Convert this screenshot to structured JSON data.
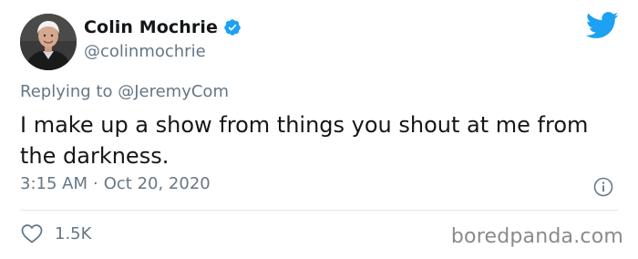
{
  "tweet": {
    "display_name": "Colin Mochrie",
    "handle": "@colinmochrie",
    "verified": true,
    "replying_prefix": "Replying to",
    "replying_to": "@JeremyCom",
    "text": "I make up a show from things you shout at me from the darkness.",
    "time": "3:15 AM",
    "separator": "·",
    "date": "Oct 20, 2020",
    "likes_count": "1.5K"
  },
  "watermark": "boredpanda.com",
  "colors": {
    "twitter_blue": "#1da1f2",
    "secondary_text": "#657786",
    "primary_text": "#14171a"
  },
  "icons": {
    "brand": "twitter-bird-icon",
    "verified": "verified-badge-icon",
    "info": "info-icon",
    "like": "heart-icon"
  }
}
